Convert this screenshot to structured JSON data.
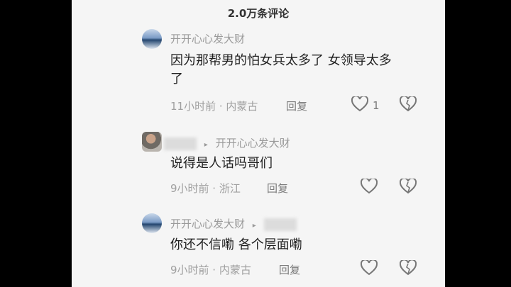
{
  "header": {
    "title": "2.0万条评论"
  },
  "comments": [
    {
      "author": "开开心心发大财",
      "text_line1": "因为那帮男的怕女兵太多了 女领导太多",
      "text_line2": "了",
      "meta": "11小时前 · 内蒙古",
      "reply_label": "回复",
      "like_count": "1"
    },
    {
      "author": "开开心心发大财",
      "text_line1": "说得是人话吗哥们",
      "meta": "9小时前 · 浙江",
      "reply_label": "回复"
    },
    {
      "author": "开开心心发大财",
      "text_line1": "你还不信嘞 各个层面嘞",
      "meta": "9小时前 · 内蒙古",
      "reply_label": "回复"
    }
  ],
  "icons": {
    "like": "heart-icon",
    "dislike": "broken-heart-icon",
    "reply_arrow": "triangle-right-icon"
  }
}
